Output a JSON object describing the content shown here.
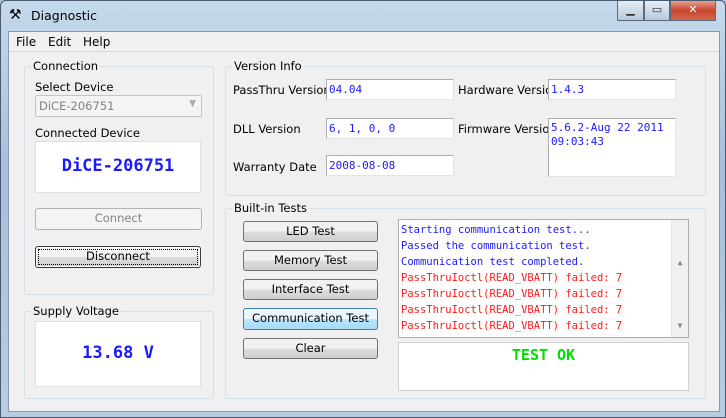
{
  "window": {
    "title": "Diagnostic",
    "icon": "tools-icon"
  },
  "menu": [
    "File",
    "Edit",
    "Help"
  ],
  "connection": {
    "group_label": "Connection",
    "select_device_label": "Select Device",
    "select_device_value": "DiCE-206751",
    "connected_device_label": "Connected Device",
    "connected_device_value": "DiCE-206751",
    "connect_label": "Connect",
    "disconnect_label": "Disconnect"
  },
  "supply": {
    "group_label": "Supply Voltage",
    "value": "13.68 V"
  },
  "version": {
    "group_label": "Version Info",
    "passthru_label": "PassThru Version",
    "passthru_value": "04.04",
    "dll_label": "DLL Version",
    "dll_value": "6, 1, 0, 0",
    "warranty_label": "Warranty Date",
    "warranty_value": "2008-08-08",
    "hardware_label": "Hardware Version",
    "hardware_value": "1.4.3",
    "firmware_label": "Firmware Version",
    "firmware_value": "5.6.2-Aug 22 2011\n09:03:43"
  },
  "tests": {
    "group_label": "Built-in Tests",
    "buttons": [
      "LED Test",
      "Memory Test",
      "Interface Test",
      "Communication Test",
      "Clear"
    ],
    "log": [
      {
        "text": "Starting communication test...",
        "color": "#1a1aff"
      },
      {
        "text": "Passed the communication test.",
        "color": "#1a1aff"
      },
      {
        "text": "Communication test completed.",
        "color": "#1a1aff"
      },
      {
        "text": "PassThruIoctl(READ_VBATT) failed: 7",
        "color": "#ff1a1a"
      },
      {
        "text": "PassThruIoctl(READ_VBATT) failed: 7",
        "color": "#ff1a1a"
      },
      {
        "text": "PassThruIoctl(READ_VBATT) failed: 7",
        "color": "#ff1a1a"
      },
      {
        "text": "PassThruIoctl(READ_VBATT) failed: 7",
        "color": "#ff1a1a"
      }
    ],
    "status": "TEST OK",
    "status_color": "#00e000"
  }
}
